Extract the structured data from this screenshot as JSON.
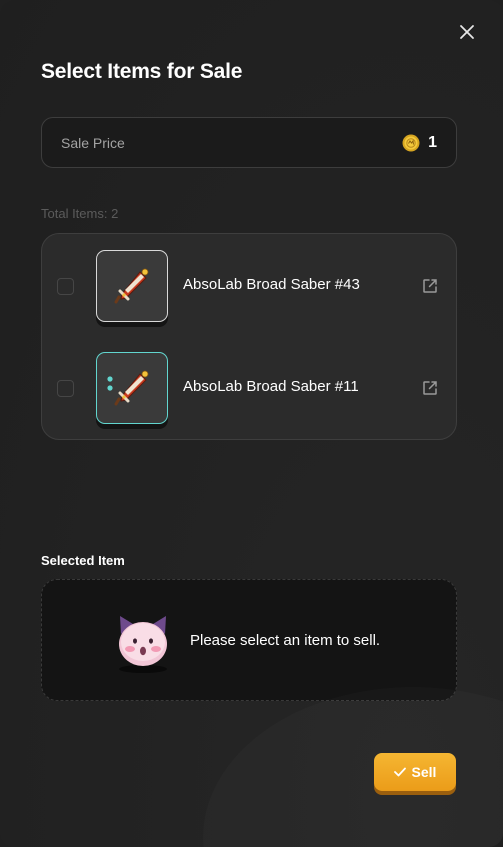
{
  "modal": {
    "title": "Select Items for Sale",
    "close_icon": "close-icon"
  },
  "price": {
    "label": "Sale Price",
    "coin_icon": "coin-icon",
    "value": "1"
  },
  "items": {
    "total_label": "Total Items: 2",
    "list": [
      {
        "name": "AbsoLab Broad Saber #43",
        "checked": false,
        "thumb_border": "#d9d9d9",
        "icon": "broad-saber-icon"
      },
      {
        "name": "AbsoLab Broad Saber #11",
        "checked": false,
        "thumb_border": "#62d6cf",
        "icon": "broad-saber-icon"
      }
    ]
  },
  "selected": {
    "label": "Selected Item",
    "placeholder": "Please select an item to sell.",
    "mascot_icon": "pink-cat-mascot-icon"
  },
  "sell_button": {
    "label": "Sell",
    "icon": "check-icon",
    "color": "#f0a820"
  },
  "colors": {
    "background": "#232323",
    "accent": "#f0a820",
    "teal": "#62d6cf"
  }
}
